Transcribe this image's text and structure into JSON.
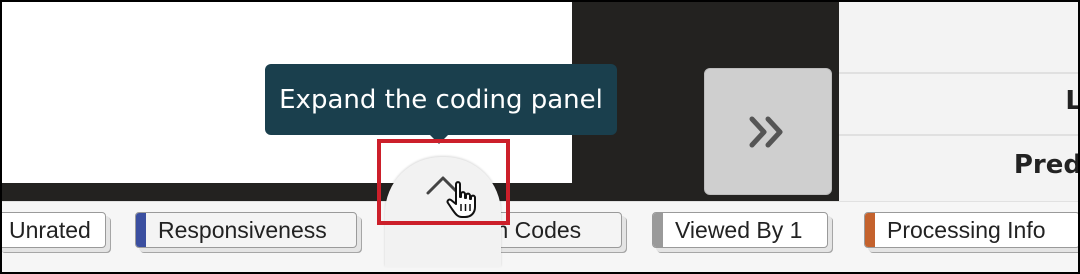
{
  "tooltip": {
    "text": "Expand the coding panel"
  },
  "right_panel": {
    "line1": "L",
    "line2": "Pred"
  },
  "icons": {
    "next": "double-chevron-right-icon",
    "expand": "chevron-up-icon",
    "cursor": "hand-pointer-icon"
  },
  "tabs": [
    {
      "label": "Unrated",
      "color": ""
    },
    {
      "label": "Responsiveness",
      "color": "#3b4fa0"
    },
    {
      "label": "Freeform Codes",
      "color": "#9a9a9a"
    },
    {
      "label": "Viewed By 1",
      "color": "#9a9a9a"
    },
    {
      "label": "Processing Info",
      "color": "#c4622d"
    }
  ],
  "colors": {
    "tooltip_bg": "#1a3f4d",
    "highlight": "#cc1f2a",
    "dark_bg": "#232220"
  }
}
